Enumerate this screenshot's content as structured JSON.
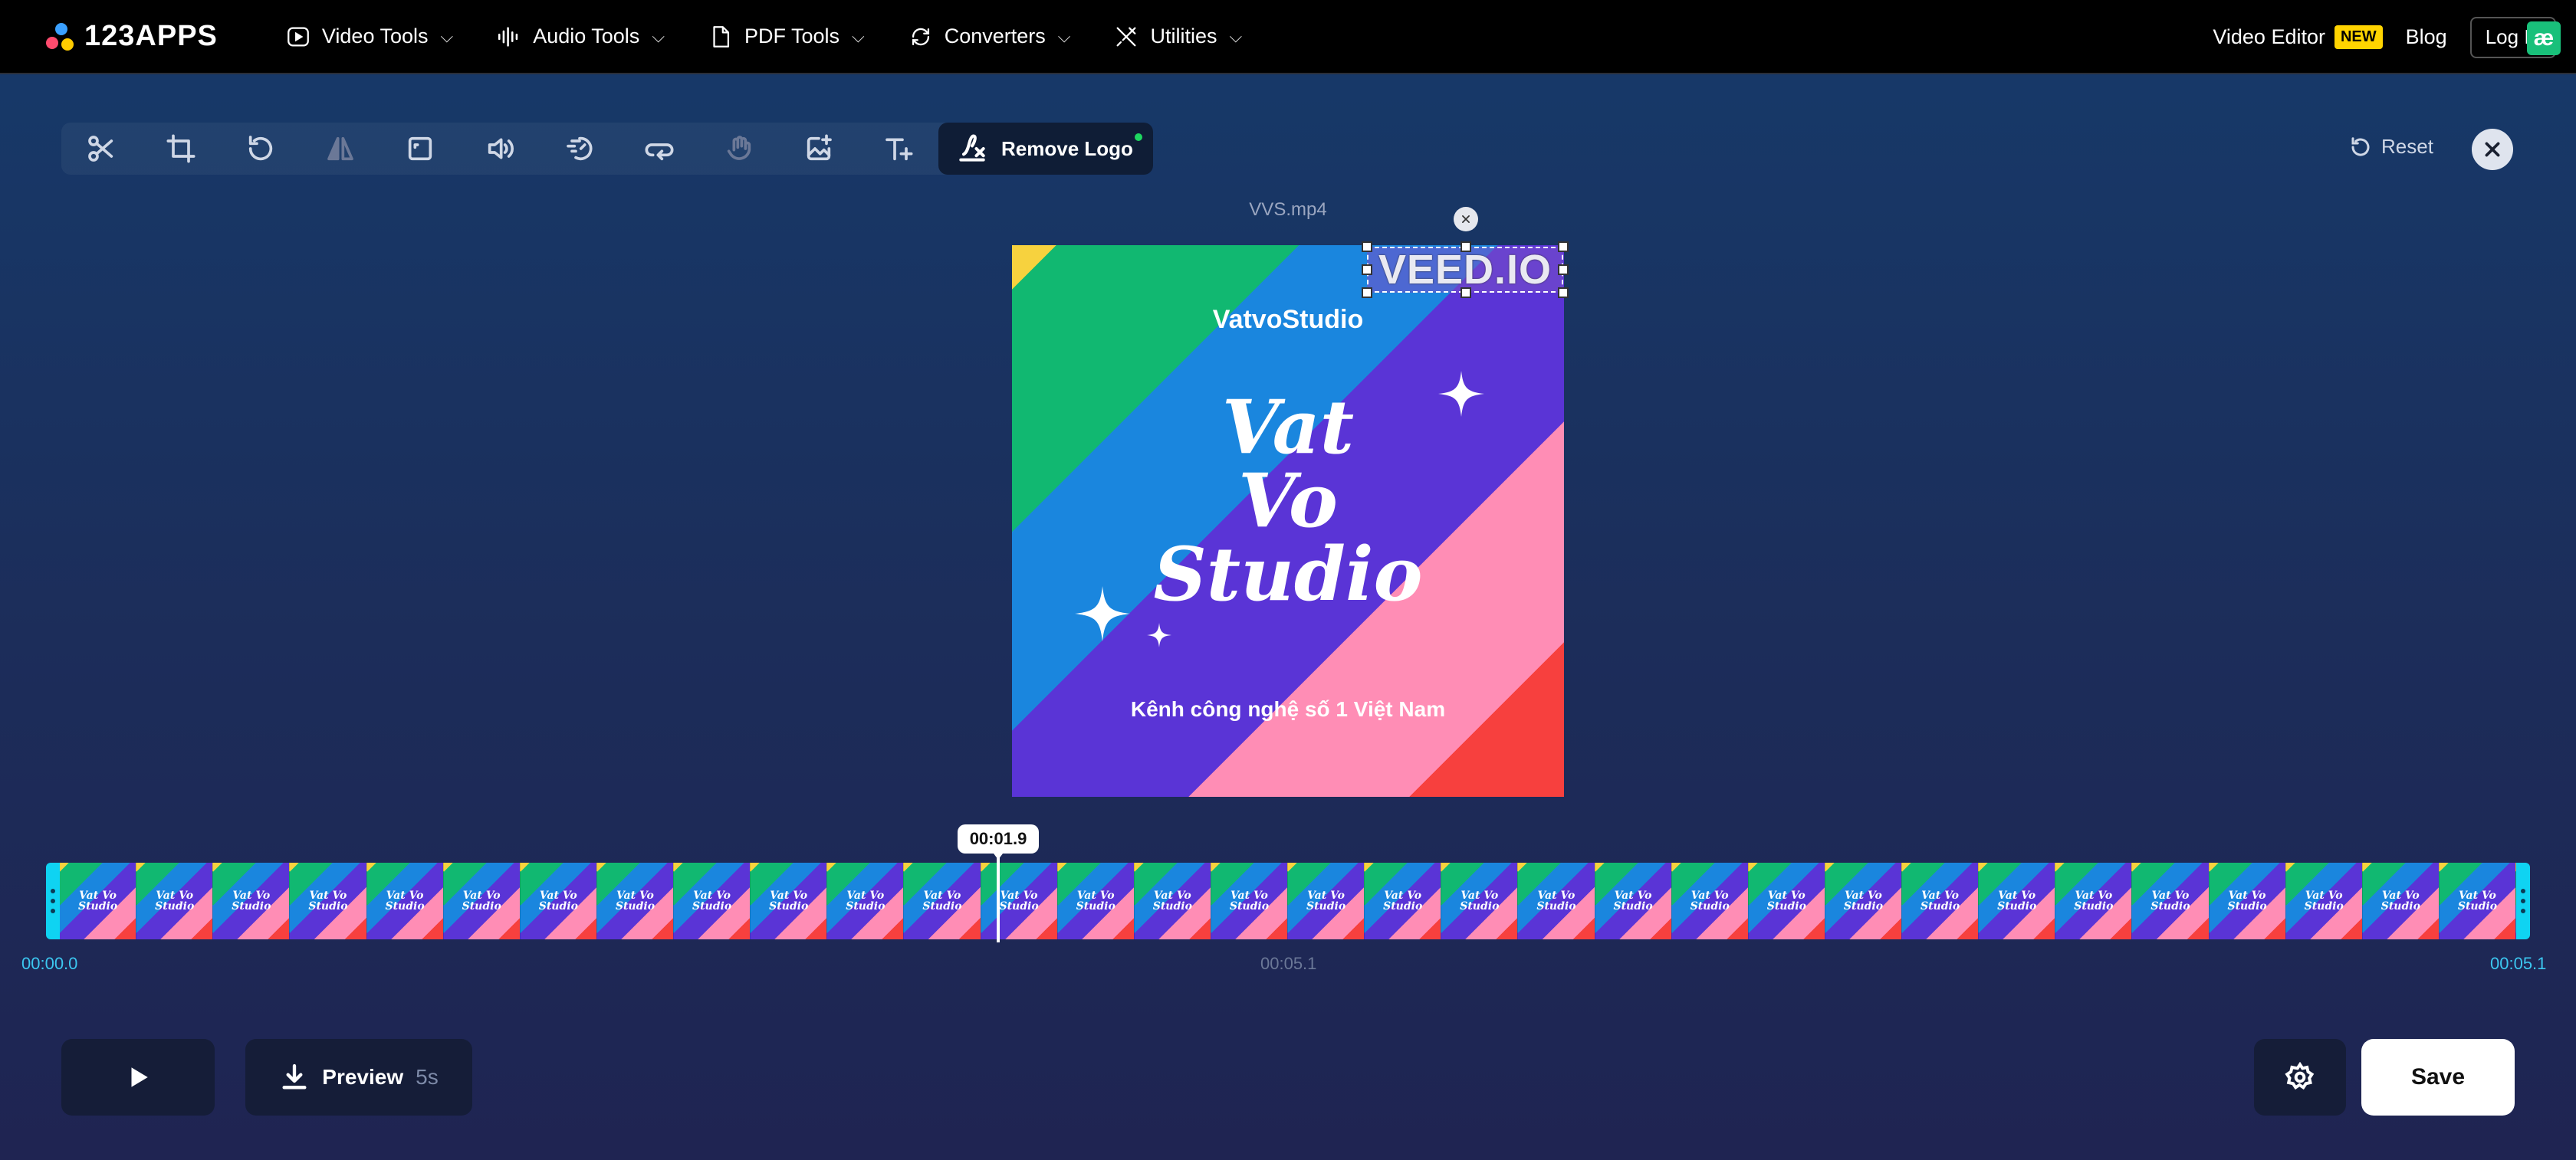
{
  "nav": {
    "logo": "123APPS",
    "menu": [
      {
        "label": "Video Tools",
        "icon": "play-circle-icon"
      },
      {
        "label": "Audio Tools",
        "icon": "waveform-icon"
      },
      {
        "label": "PDF Tools",
        "icon": "document-icon"
      },
      {
        "label": "Converters",
        "icon": "convert-icon"
      },
      {
        "label": "Utilities",
        "icon": "tools-icon"
      }
    ],
    "video_editor": "Video Editor",
    "new_badge": "NEW",
    "blog": "Blog",
    "login": "Log In",
    "ae_badge": "æ"
  },
  "toolbar": {
    "tools": [
      "scissors-icon",
      "crop-icon",
      "rotate-icon",
      "flip-icon",
      "resize-icon",
      "volume-icon",
      "speed-icon",
      "loop-icon",
      "stabilize-icon",
      "add-image-icon",
      "add-text-icon"
    ],
    "active_label": "Remove Logo",
    "reset_label": "Reset"
  },
  "preview": {
    "filename": "VVS.mp4",
    "channel": "VatvoStudio",
    "title_line1": "Vat",
    "title_line2": "Vo",
    "title_line3": "Studio",
    "tagline": "Kênh công nghệ số 1 Việt Nam",
    "watermark": "VEED.IO"
  },
  "timeline": {
    "current_time": "00:01.9",
    "start": "00:00.0",
    "mid": "00:05.1",
    "end": "00:05.1",
    "thumb_count": 32,
    "thumb_text": "Vat Vo Studio"
  },
  "footer": {
    "preview_label": "Preview",
    "preview_duration": "5s",
    "save_label": "Save"
  }
}
